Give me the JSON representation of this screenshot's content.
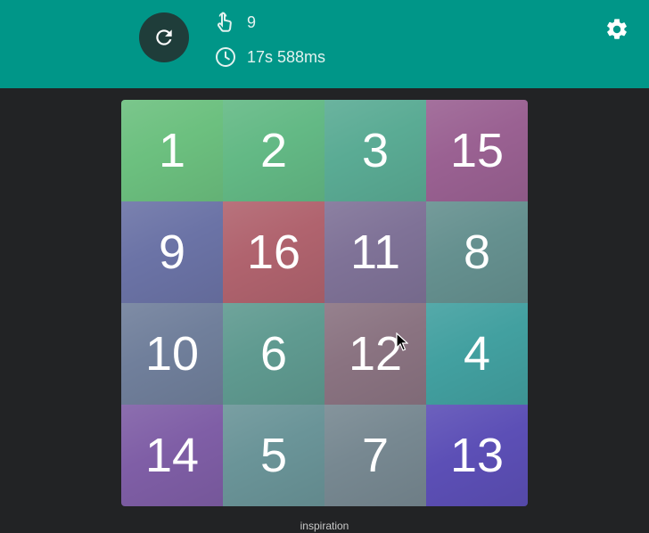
{
  "game": {
    "moves": "9",
    "time": "17s 588ms",
    "icons": {
      "reset": "refresh-icon",
      "moves": "tap-hand-icon",
      "time": "clock-icon",
      "settings": "gear-icon"
    },
    "colors": {
      "header": "#009688",
      "background": "#222325",
      "reset_button": "#1f3d3a"
    }
  },
  "board": {
    "tiles": [
      {
        "label": "1",
        "color": "#6cc07f"
      },
      {
        "label": "2",
        "color": "#63b985"
      },
      {
        "label": "3",
        "color": "#5aab94"
      },
      {
        "label": "15",
        "color": "#9a6192"
      },
      {
        "label": "9",
        "color": "#6b73a6"
      },
      {
        "label": "16",
        "color": "#b0636e"
      },
      {
        "label": "11",
        "color": "#7f7297"
      },
      {
        "label": "8",
        "color": "#65908f"
      },
      {
        "label": "10",
        "color": "#707f9b"
      },
      {
        "label": "6",
        "color": "#5f9a90"
      },
      {
        "label": "12",
        "color": "#8a7381"
      },
      {
        "label": "4",
        "color": "#42a0a0"
      },
      {
        "label": "14",
        "color": "#7f5ea6"
      },
      {
        "label": "5",
        "color": "#6a9498"
      },
      {
        "label": "7",
        "color": "#778891"
      },
      {
        "label": "13",
        "color": "#5c4fb6"
      }
    ]
  },
  "footer": {
    "link": "inspiration"
  }
}
